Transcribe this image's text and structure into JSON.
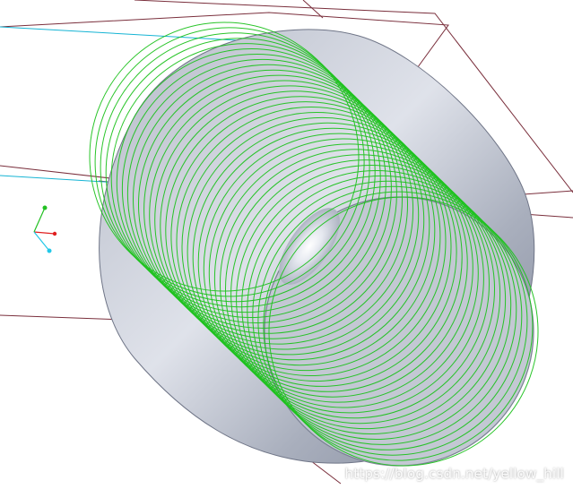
{
  "viewport": {
    "background": "#ffffff",
    "model": {
      "body_color": "#c8ccd6",
      "body_shade": "#8c93a6",
      "highlight": "#f4f6fb",
      "helix_color": "#1fc21f",
      "helix_turns": 34
    },
    "datum_planes": {
      "color": "#7a2f3c"
    },
    "datum_axis": {
      "color": "#16b4d4"
    },
    "triad": {
      "x_color": "#e02020",
      "y_color": "#22c022",
      "z_color": "#22c8e8",
      "icon": "coordinate-system-icon"
    }
  },
  "watermark": {
    "text": "https://blog.csdn.net/yellow_hill"
  }
}
